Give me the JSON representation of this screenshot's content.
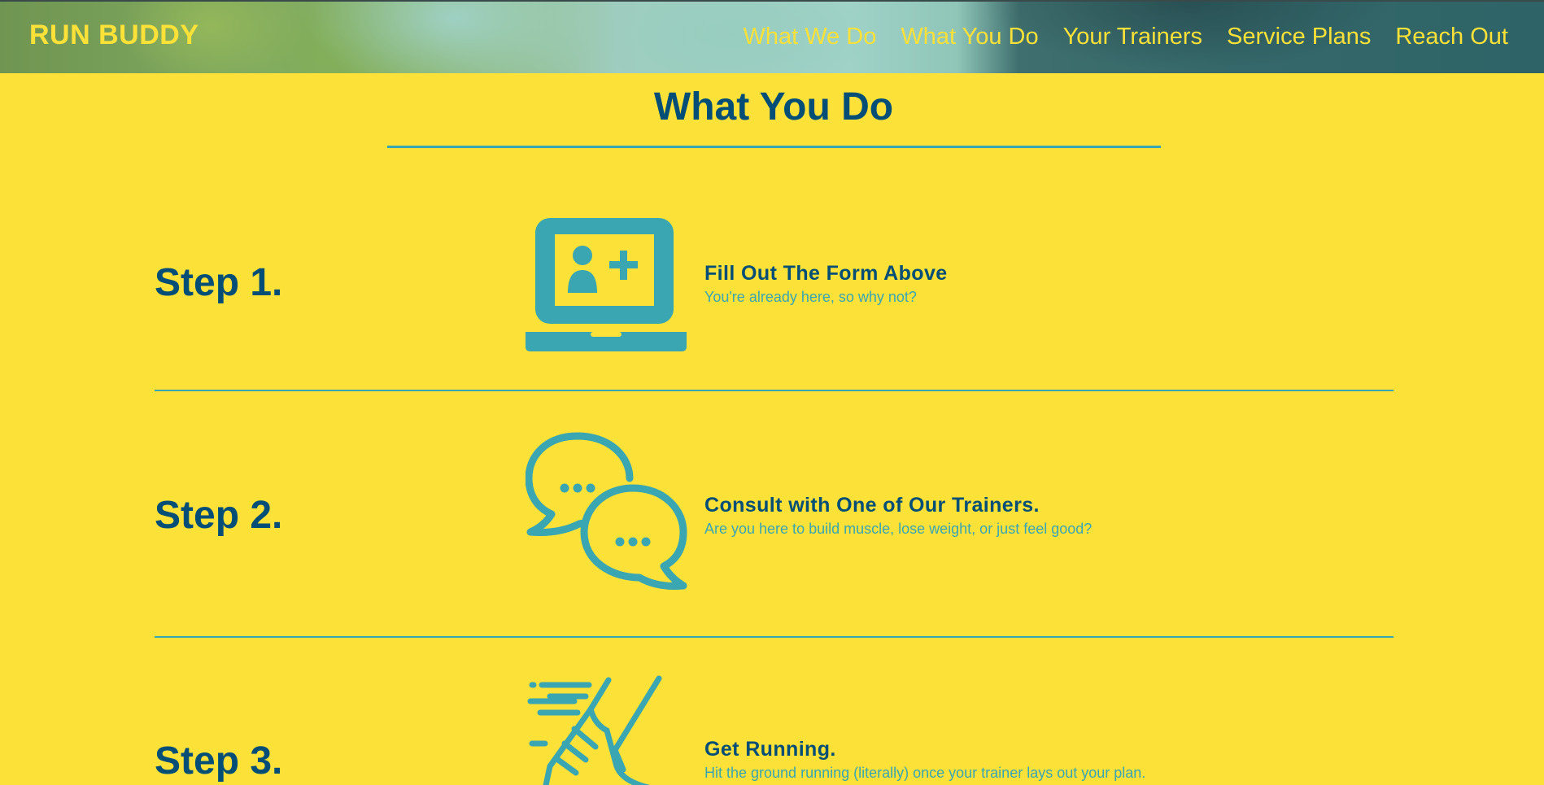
{
  "header": {
    "logo": "RUN BUDDY",
    "nav": [
      "What We Do",
      "What You Do",
      "Your Trainers",
      "Service Plans",
      "Reach Out"
    ]
  },
  "main": {
    "title": "What You Do",
    "steps": [
      {
        "number": "Step 1.",
        "icon": "laptop-add-user-icon",
        "heading": "Fill Out The Form Above",
        "description": "You're already here, so why not?"
      },
      {
        "number": "Step 2.",
        "icon": "chat-bubbles-icon",
        "heading": "Consult with One of Our Trainers.",
        "description": "Are you here to build muscle, lose weight, or just feel good?"
      },
      {
        "number": "Step 3.",
        "icon": "running-shoe-icon",
        "heading": "Get Running.",
        "description": "Hit the ground running (literally) once your trainer lays out your plan."
      }
    ]
  },
  "colors": {
    "background": "#fce138",
    "primary": "#024e76",
    "accent": "#39a6b2"
  }
}
